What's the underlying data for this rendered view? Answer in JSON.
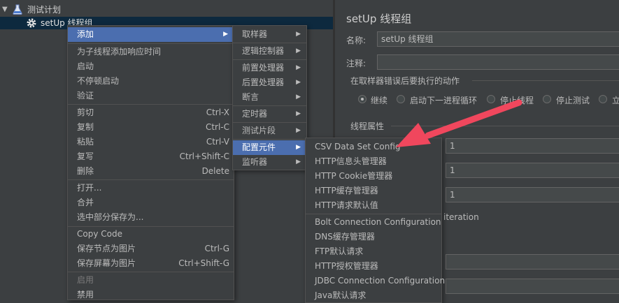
{
  "tree": {
    "root_label": "测试计划",
    "child_label": "setUp 线程组"
  },
  "panel": {
    "title": "setUp 线程组",
    "name_label": "名称:",
    "name_value": "setUp 线程组",
    "comment_label": "注释:",
    "comment_value": "",
    "error_action_title": "在取样器错误后要执行的动作",
    "error_actions": [
      {
        "label": "继续",
        "selected": true
      },
      {
        "label": "启动下一进程循环",
        "selected": false
      },
      {
        "label": "停止线程",
        "selected": false
      },
      {
        "label": "停止测试",
        "selected": false
      },
      {
        "label": "立",
        "selected": false
      }
    ],
    "thread_props_title": "线程属性",
    "field_values": [
      "1",
      "1",
      "1"
    ],
    "iteration_text": "iteration"
  },
  "context_menu": {
    "items": [
      {
        "label": "添加",
        "shortcut": "",
        "submenu": true,
        "highlighted": true
      },
      {
        "label": "为子线程添加响应时间",
        "shortcut": ""
      },
      {
        "label": "启动",
        "shortcut": ""
      },
      {
        "label": "不停顿启动",
        "shortcut": ""
      },
      {
        "label": "验证",
        "shortcut": ""
      },
      {
        "label": "剪切",
        "shortcut": "Ctrl-X"
      },
      {
        "label": "复制",
        "shortcut": "Ctrl-C"
      },
      {
        "label": "粘贴",
        "shortcut": "Ctrl-V"
      },
      {
        "label": "复写",
        "shortcut": "Ctrl+Shift-C"
      },
      {
        "label": "删除",
        "shortcut": "Delete"
      },
      {
        "label": "打开...",
        "shortcut": ""
      },
      {
        "label": "合并",
        "shortcut": ""
      },
      {
        "label": "选中部分保存为...",
        "shortcut": ""
      },
      {
        "label": "Copy Code",
        "shortcut": ""
      },
      {
        "label": "保存节点为图片",
        "shortcut": "Ctrl-G"
      },
      {
        "label": "保存屏幕为图片",
        "shortcut": "Ctrl+Shift-G"
      },
      {
        "label": "启用",
        "shortcut": "",
        "disabled": true
      },
      {
        "label": "禁用",
        "shortcut": ""
      }
    ]
  },
  "add_submenu": {
    "items": [
      {
        "label": "取样器"
      },
      {
        "label": "逻辑控制器"
      },
      {
        "label": "前置处理器"
      },
      {
        "label": "后置处理器"
      },
      {
        "label": "断言"
      },
      {
        "label": "定时器"
      },
      {
        "label": "测试片段"
      },
      {
        "label": "配置元件",
        "highlighted": true
      },
      {
        "label": "监听器"
      }
    ]
  },
  "config_submenu": {
    "items": [
      {
        "label": "CSV Data Set Config"
      },
      {
        "label": "HTTP信息头管理器"
      },
      {
        "label": "HTTP Cookie管理器"
      },
      {
        "label": "HTTP缓存管理器"
      },
      {
        "label": "HTTP请求默认值"
      },
      {
        "label": "Bolt Connection Configuration"
      },
      {
        "label": "DNS缓存管理器"
      },
      {
        "label": "FTP默认请求"
      },
      {
        "label": "HTTP授权管理器"
      },
      {
        "label": "JDBC Connection Configuration"
      },
      {
        "label": "Java默认请求"
      }
    ]
  },
  "icons": {
    "tree_expand": "chevron-down-icon",
    "test_plan": "flask-icon",
    "setup_thread_group": "gear-icon",
    "submenu_arrow": "triangle-right-icon",
    "annotation": "red-arrow-annotation"
  },
  "colors": {
    "background": "#3c3f41",
    "highlight": "#4b6eaf",
    "selection": "#0d293e",
    "annotation_arrow": "#f0475d"
  }
}
